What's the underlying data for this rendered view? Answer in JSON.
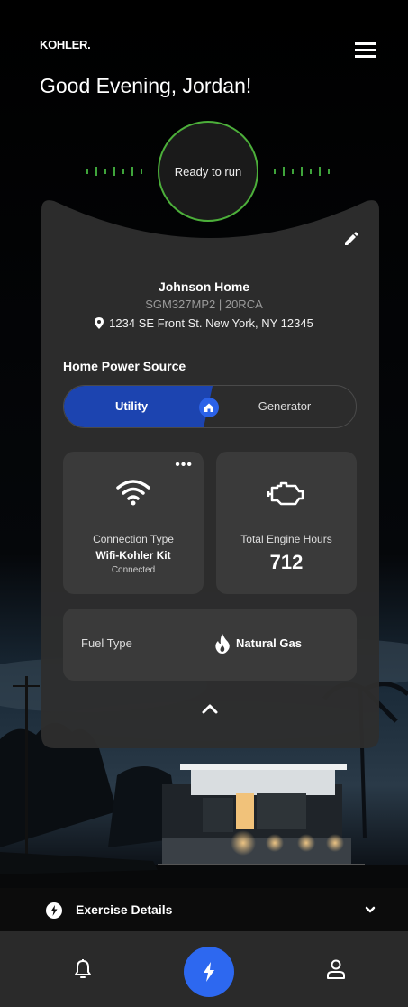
{
  "header": {
    "logo": "KOHLER.",
    "greeting": "Good Evening, Jordan!"
  },
  "status": {
    "text": "Ready to run"
  },
  "home": {
    "name": "Johnson Home",
    "model": "SGM327MP2 | 20RCA",
    "address": "1234 SE Front St. New York, NY 12345"
  },
  "power_source": {
    "label": "Home Power Source",
    "options": [
      "Utility",
      "Generator"
    ],
    "selected": "Utility"
  },
  "connection": {
    "label": "Connection Type",
    "value": "Wifi-Kohler Kit",
    "status": "Connected",
    "more": "•••"
  },
  "engine": {
    "label": "Total Engine Hours",
    "value": "712"
  },
  "fuel": {
    "label": "Fuel Type",
    "value": "Natural Gas"
  },
  "exercise": {
    "label": "Exercise Details"
  },
  "colors": {
    "accent_blue": "#2d68f0",
    "utility_blue": "#1c44b0",
    "status_green": "#4caf3a",
    "card_bg": "#2e2e2e",
    "tile_bg": "#3a3a3a"
  },
  "icons": {
    "menu": "menu-icon",
    "edit": "pencil-icon",
    "location": "location-pin-icon",
    "wifi": "wifi-icon",
    "engine": "engine-icon",
    "flame": "flame-icon",
    "collapse": "chevron-up-icon",
    "exercise": "lightning-circle-icon",
    "expand": "chevron-down-icon",
    "notifications": "bell-icon",
    "power": "lightning-icon",
    "profile": "user-icon"
  }
}
